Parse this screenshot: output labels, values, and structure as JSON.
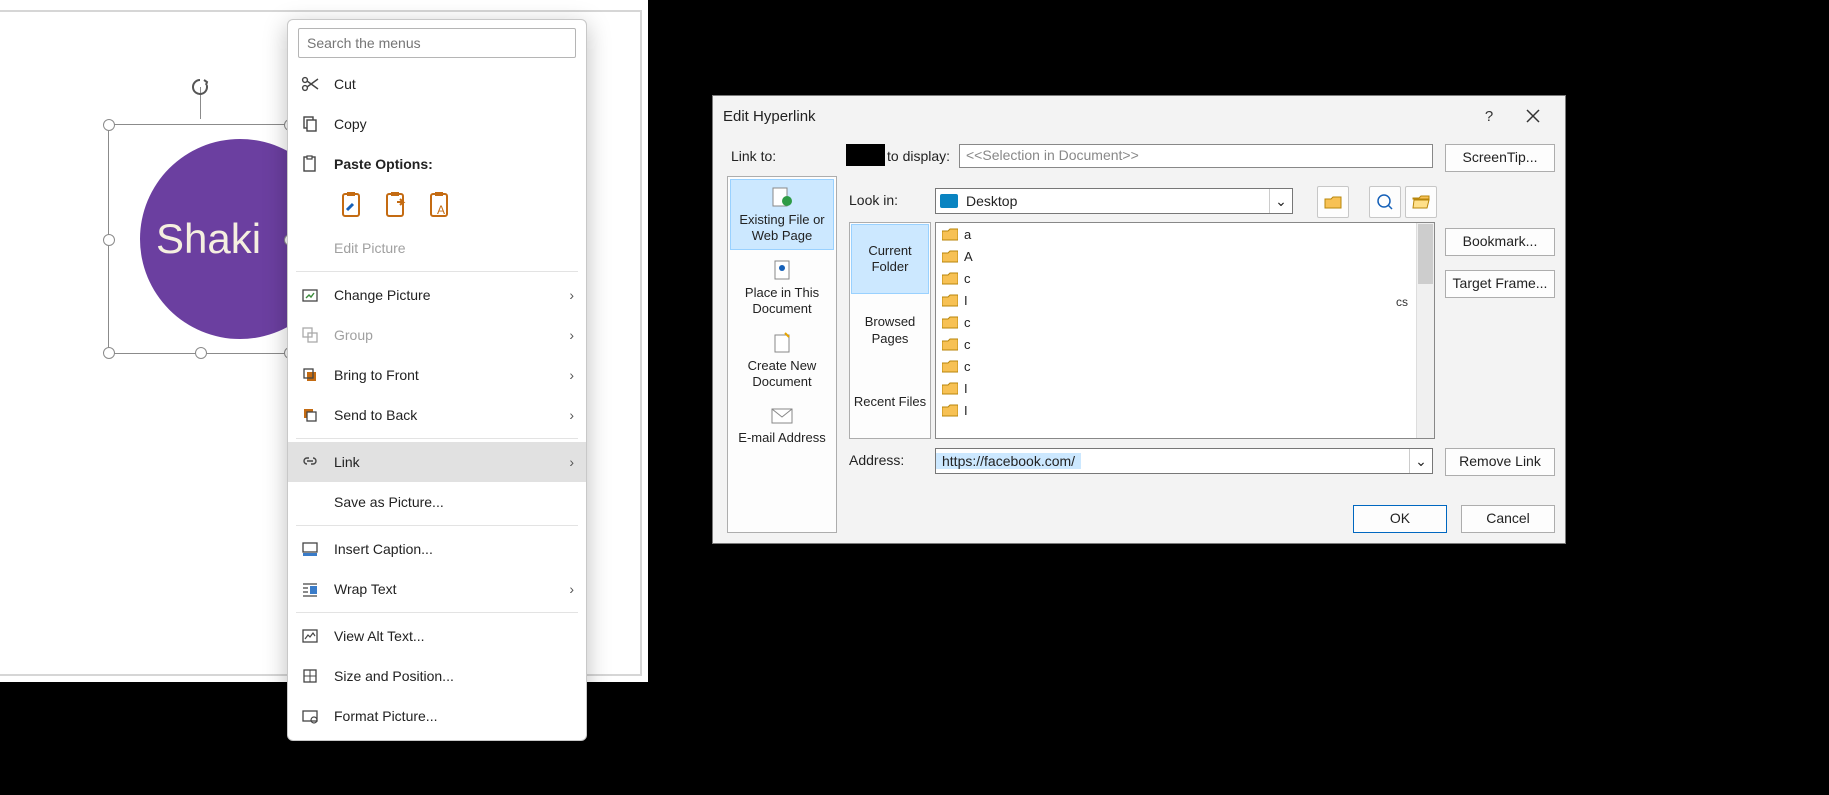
{
  "word": {
    "circle_text": "Shaki",
    "search_placeholder": "Search the menus",
    "menu": {
      "cut": "Cut",
      "copy": "Copy",
      "paste_options": "Paste Options:",
      "edit_picture": "Edit Picture",
      "change_picture": "Change Picture",
      "group": "Group",
      "bring_front": "Bring to Front",
      "send_back": "Send to Back",
      "link": "Link",
      "save_as_picture": "Save as Picture...",
      "insert_caption": "Insert Caption...",
      "wrap_text": "Wrap Text",
      "view_alt_text": "View Alt Text...",
      "size_position": "Size and Position...",
      "format_picture": "Format Picture..."
    }
  },
  "dlg": {
    "title": "Edit Hyperlink",
    "link_to": "Link to:",
    "to_display": "to display:",
    "display_value": "<<Selection in Document>>",
    "screentip": "ScreenTip...",
    "bookmark": "Bookmark...",
    "target_frame": "Target Frame...",
    "remove_link": "Remove Link",
    "ok": "OK",
    "cancel": "Cancel",
    "linkto_opts": {
      "existing": "Existing File or Web Page",
      "place": "Place in This Document",
      "create": "Create New Document",
      "email": "E-mail Address"
    },
    "look_in": "Look in:",
    "look_in_value": "Desktop",
    "subtabs": {
      "current": "Current Folder",
      "browsed": "Browsed Pages",
      "recent": "Recent Files"
    },
    "files": [
      "a",
      "A",
      "c",
      "I",
      "c",
      "c",
      "c",
      "I",
      "I"
    ],
    "cs_overflow": "cs",
    "address_label": "Address:",
    "address_value": "https://facebook.com/"
  }
}
